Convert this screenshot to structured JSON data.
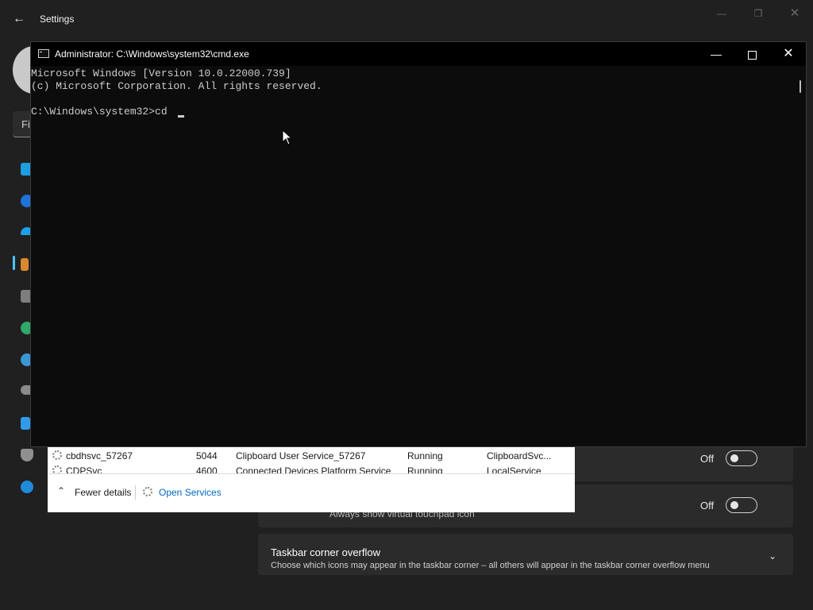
{
  "settings": {
    "title": "Settings",
    "back_icon": "arrow-left-icon",
    "find_placeholder": "Fi",
    "rows": [
      {
        "state": "Off"
      },
      {
        "description": "Always show virtual touchpad icon",
        "state": "Off"
      }
    ],
    "taskbar_corner_overflow": {
      "title": "Taskbar corner overflow",
      "description": "Choose which icons may appear in the taskbar corner – all others will appear in the taskbar corner overflow menu"
    }
  },
  "task_manager": {
    "services": [
      {
        "name": "cbdhsvc_57267",
        "pid": "5044",
        "description": "Clipboard User Service_57267",
        "status": "Running",
        "group": "ClipboardSvc..."
      },
      {
        "name": "CDPSvc",
        "pid": "4600",
        "description": "Connected Devices Platform Service",
        "status": "Running",
        "group": "LocalService"
      }
    ],
    "fewer_details": "Fewer details",
    "open_services": "Open Services"
  },
  "cmd": {
    "title": "Administrator: C:\\Windows\\system32\\cmd.exe",
    "lines": [
      "Microsoft Windows [Version 10.0.22000.739]",
      "(c) Microsoft Corporation. All rights reserved.",
      "",
      "C:\\Windows\\system32>cd "
    ]
  },
  "colors": {
    "accent": "#4cc2ff",
    "console_bg": "#0c0c0c",
    "console_text": "#cccccc",
    "settings_bg": "#202020",
    "card_bg": "#2b2b2b",
    "link": "#0067c0"
  }
}
